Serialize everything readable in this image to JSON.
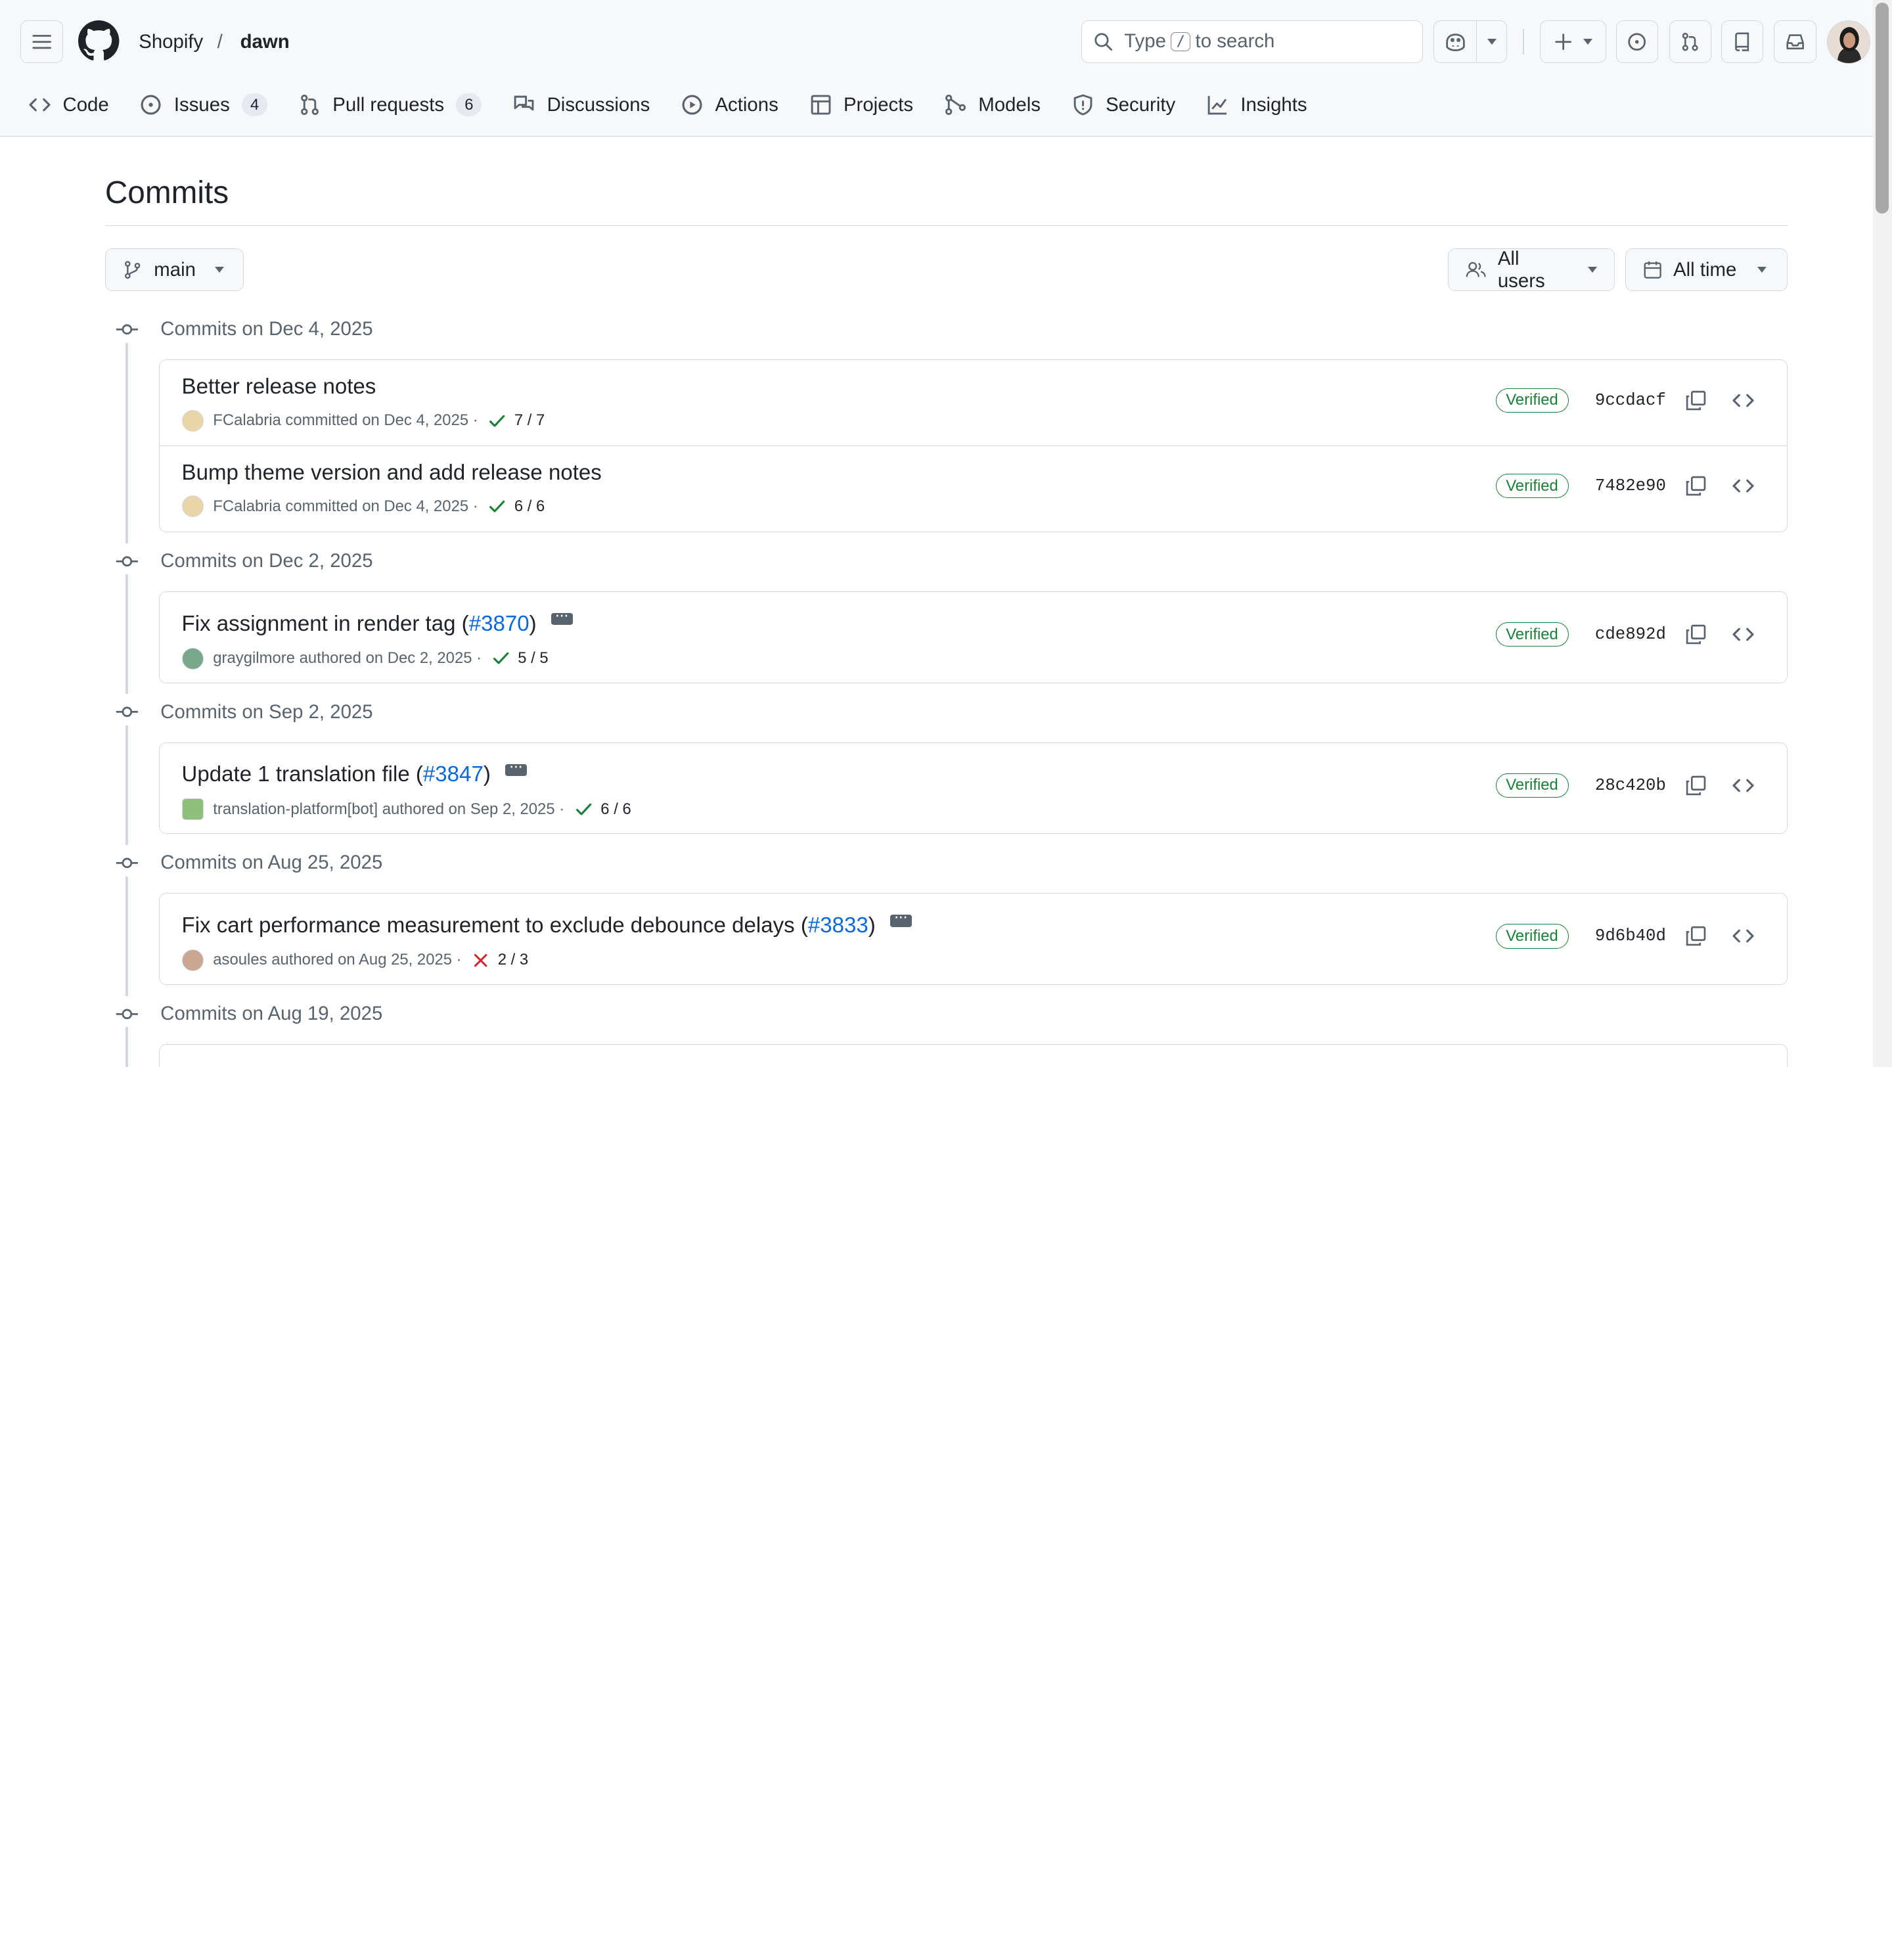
{
  "header": {
    "owner": "Shopify",
    "separator": "/",
    "repo": "dawn",
    "search_prefix": "Type",
    "search_key": "/",
    "search_suffix": "to search"
  },
  "tabs": [
    {
      "label": "Code",
      "icon": "code-icon"
    },
    {
      "label": "Issues",
      "icon": "issue-opened-icon",
      "count": "4"
    },
    {
      "label": "Pull requests",
      "icon": "git-pull-request-icon",
      "count": "6"
    },
    {
      "label": "Discussions",
      "icon": "comment-discussion-icon"
    },
    {
      "label": "Actions",
      "icon": "play-icon"
    },
    {
      "label": "Projects",
      "icon": "table-icon"
    },
    {
      "label": "Models",
      "icon": "ai-model-icon"
    },
    {
      "label": "Security",
      "icon": "shield-icon"
    },
    {
      "label": "Insights",
      "icon": "graph-icon"
    }
  ],
  "page": {
    "title": "Commits",
    "branch": "main",
    "users_filter": "All users",
    "time_filter": "All time"
  },
  "groups": [
    {
      "date_label": "Commits on Dec 4, 2025",
      "commits": [
        {
          "title": "Better release notes",
          "pr": "",
          "author": "FCalabria",
          "action": "committed",
          "date": "on Dec 4, 2025",
          "checks": "7 / 7",
          "status": "success",
          "verified": "Verified",
          "sha": "9ccdacf"
        },
        {
          "title": "Bump theme version and add release notes",
          "pr": "",
          "author": "FCalabria",
          "action": "committed",
          "date": "on Dec 4, 2025",
          "checks": "6 / 6",
          "status": "success",
          "verified": "Verified",
          "sha": "7482e90"
        }
      ]
    },
    {
      "date_label": "Commits on Dec 2, 2025",
      "commits": [
        {
          "title": "Fix assignment in render tag (",
          "pr": "#3870",
          "title_end": ")",
          "author": "graygilmore",
          "action": "authored",
          "date": "on Dec 2, 2025",
          "checks": "5 / 5",
          "status": "success",
          "verified": "Verified",
          "sha": "cde892d"
        }
      ]
    },
    {
      "date_label": "Commits on Sep 2, 2025",
      "commits": [
        {
          "title": "Update 1 translation file (",
          "pr": "#3847",
          "title_end": ")",
          "author": "translation-platform[bot]",
          "action": "authored",
          "date": "on Sep 2, 2025",
          "checks": "6 / 6",
          "status": "success",
          "verified": "Verified",
          "sha": "28c420b"
        }
      ]
    },
    {
      "date_label": "Commits on Aug 25, 2025",
      "commits": [
        {
          "title": "Fix cart performance measurement to exclude debounce delays (",
          "pr": "#3833",
          "title_end": ")",
          "author": "asoules",
          "action": "authored",
          "date": "on Aug 25, 2025",
          "checks": "2 / 3",
          "status": "failure",
          "verified": "Verified",
          "sha": "9d6b40d"
        }
      ]
    },
    {
      "date_label": "Commits on Aug 19, 2025",
      "commits": []
    }
  ],
  "colors": {
    "accent": "#0969da",
    "success": "#1a7f37",
    "danger": "#d1242f",
    "border": "#d1d9e0"
  }
}
